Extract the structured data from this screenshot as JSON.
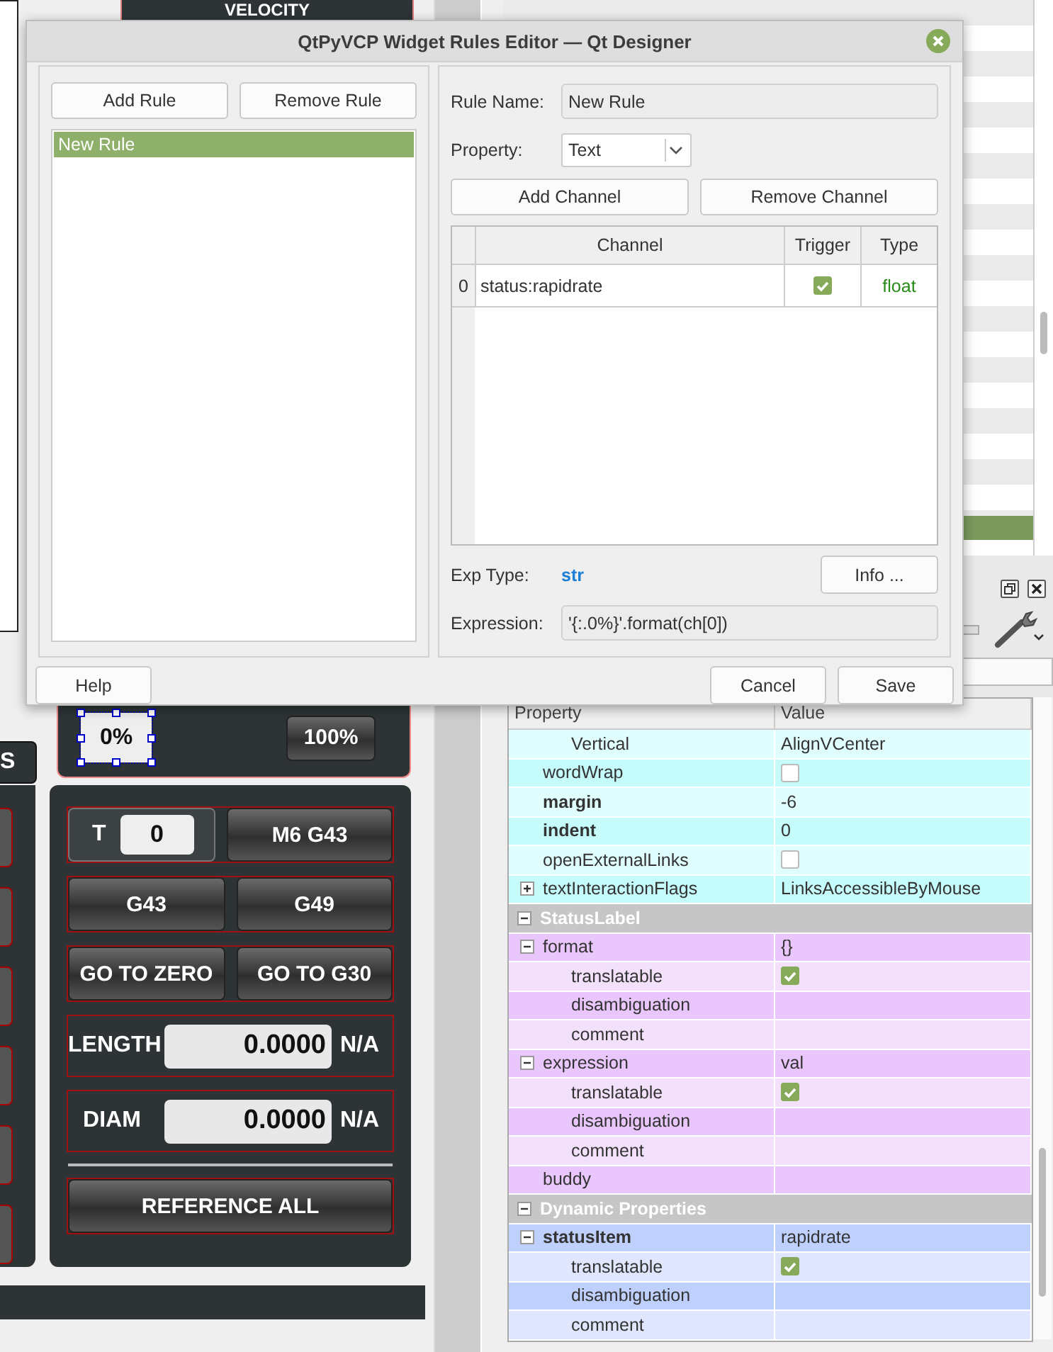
{
  "designer_form": {
    "header": "VELOCITY",
    "side_button": "S",
    "rate_panel": {
      "label": {
        "text": "0%",
        "selected": true
      },
      "button": "100%"
    },
    "tool_panel": {
      "rows": [
        {
          "kind": "tool",
          "label": "T",
          "value": "0",
          "buttons": [
            "M6 G43"
          ]
        },
        {
          "kind": "buttons",
          "buttons": [
            "G43",
            "G49"
          ]
        },
        {
          "kind": "buttons",
          "buttons": [
            "GO TO ZERO",
            "GO TO G30"
          ]
        },
        {
          "kind": "offset",
          "label": "LENGTH",
          "value": "0.0000",
          "unit": "N/A"
        },
        {
          "kind": "offset",
          "label": "DIAM",
          "value": "0.0000",
          "unit": "N/A"
        },
        {
          "kind": "separator"
        },
        {
          "kind": "wide",
          "buttons": [
            "REFERENCE ALL"
          ]
        }
      ]
    }
  },
  "property_editor": {
    "columns": [
      "Property",
      "Value"
    ],
    "sections": [
      {
        "rows": [
          {
            "children": [
              {
                "name": "Vertical",
                "kind": "text",
                "value": "AlignVCenter",
                "changed": false
              }
            ]
          },
          {
            "name": "wordWrap",
            "kind": "checkbox",
            "checked": false,
            "changed": false
          },
          {
            "name": "margin",
            "kind": "text",
            "value": "-6",
            "changed": true
          },
          {
            "name": "indent",
            "kind": "text",
            "value": "0",
            "changed": true
          },
          {
            "name": "openExternalLinks",
            "kind": "checkbox",
            "checked": false,
            "changed": false
          },
          {
            "name": "textInteractionFlags",
            "kind": "text",
            "value": "LinksAccessibleByMouse",
            "changed": false,
            "expanded": false
          }
        ]
      },
      {
        "title": "StatusLabel",
        "expanded": true,
        "rows": [
          {
            "name": "format",
            "kind": "text",
            "value": "{}",
            "changed": false,
            "expanded": true,
            "children": [
              {
                "name": "translatable",
                "kind": "checkbox",
                "checked": true,
                "changed": false
              },
              {
                "name": "disambiguation",
                "kind": "text",
                "changed": false
              },
              {
                "name": "comment",
                "kind": "text",
                "changed": false
              }
            ]
          },
          {
            "name": "expression",
            "kind": "text",
            "value": "val",
            "changed": false,
            "expanded": true,
            "children": [
              {
                "name": "translatable",
                "kind": "checkbox",
                "checked": true,
                "changed": false
              },
              {
                "name": "disambiguation",
                "kind": "text",
                "changed": false
              },
              {
                "name": "comment",
                "kind": "text",
                "changed": false
              }
            ]
          },
          {
            "name": "buddy",
            "kind": "text",
            "changed": false
          }
        ]
      },
      {
        "title": "Dynamic Properties",
        "expanded": true,
        "rows": [
          {
            "name": "statusItem",
            "kind": "text",
            "value": "rapidrate",
            "changed": true,
            "expanded": true,
            "children": [
              {
                "name": "translatable",
                "kind": "checkbox",
                "checked": true,
                "changed": false
              },
              {
                "name": "disambiguation",
                "kind": "text",
                "changed": false
              },
              {
                "name": "comment",
                "kind": "text",
                "changed": false
              }
            ]
          }
        ]
      }
    ]
  },
  "dialog": {
    "title": "QtPyVCP Widget Rules Editor — Qt Designer",
    "rule_buttons": [
      "Add Rule",
      "Remove Rule"
    ],
    "rules": [
      {
        "name": "New Rule",
        "selected": true
      }
    ],
    "rule_name": {
      "label": "Rule Name:",
      "value": "New Rule"
    },
    "property": {
      "label": "Property:",
      "value": "Text"
    },
    "channel_buttons": [
      "Add Channel",
      "Remove Channel"
    ],
    "channels": {
      "columns": [
        "Channel",
        "Trigger",
        "Type"
      ],
      "rows": [
        {
          "index": "0",
          "channel": "status:rapidrate",
          "trigger": true,
          "type": "float"
        }
      ]
    },
    "exp_type": {
      "label": "Exp Type:",
      "value": "str"
    },
    "info_button": "Info ...",
    "expression": {
      "label": "Expression:",
      "value": "'{:.0%}'.format(ch[0])"
    },
    "footer_left_buttons": [
      "Help"
    ],
    "footer_right_buttons": [
      "Cancel",
      "Save"
    ]
  }
}
